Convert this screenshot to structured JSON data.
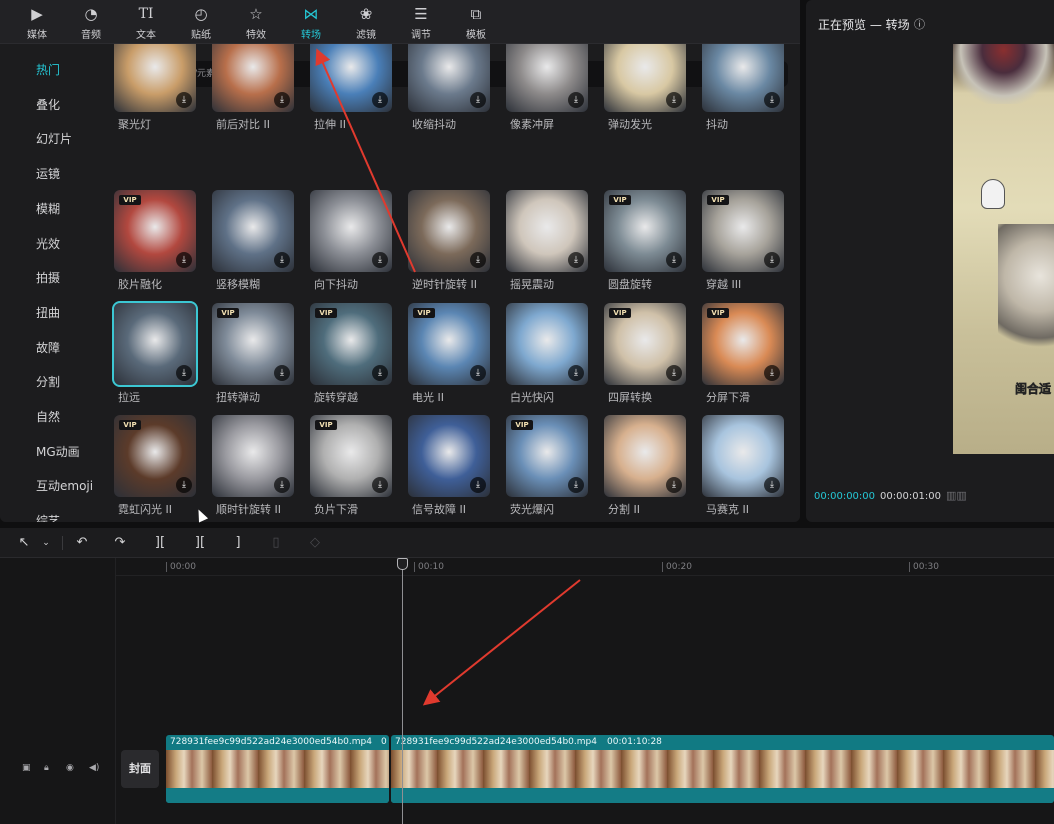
{
  "toolbar": {
    "items": [
      {
        "label": "媒体",
        "icon": "media-icon"
      },
      {
        "label": "音频",
        "icon": "audio-icon"
      },
      {
        "label": "文本",
        "icon": "text-icon"
      },
      {
        "label": "贴纸",
        "icon": "sticker-icon"
      },
      {
        "label": "特效",
        "icon": "effects-icon"
      },
      {
        "label": "转场",
        "icon": "transition-icon",
        "active": true
      },
      {
        "label": "滤镜",
        "icon": "filter-icon"
      },
      {
        "label": "调节",
        "icon": "adjust-icon"
      },
      {
        "label": "模板",
        "icon": "template-icon"
      }
    ]
  },
  "categories": [
    "热门",
    "叠化",
    "幻灯片",
    "运镜",
    "模糊",
    "光效",
    "拍摄",
    "扭曲",
    "故障",
    "分割",
    "自然",
    "MG动画",
    "互动emoji",
    "综艺"
  ],
  "active_category": "热门",
  "search": {
    "placeholder": "搜索转场名称/元素"
  },
  "transitions": [
    {
      "name": "聚光灯",
      "vip": false
    },
    {
      "name": "前后对比 II",
      "vip": false
    },
    {
      "name": "拉伸 II",
      "vip": false
    },
    {
      "name": "收缩抖动",
      "vip": false
    },
    {
      "name": "像素冲屏",
      "vip": false
    },
    {
      "name": "弹动发光",
      "vip": false
    },
    {
      "name": "抖动",
      "vip": false
    },
    {
      "name": "胶片融化",
      "vip": true
    },
    {
      "name": "竖移模糊",
      "vip": false
    },
    {
      "name": "向下抖动",
      "vip": false
    },
    {
      "name": "逆时针旋转 II",
      "vip": false
    },
    {
      "name": "摇晃震动",
      "vip": false
    },
    {
      "name": "圆盘旋转",
      "vip": true
    },
    {
      "name": "穿越 III",
      "vip": true
    },
    {
      "name": "拉远",
      "vip": false,
      "selected": true
    },
    {
      "name": "扭转弹动",
      "vip": true
    },
    {
      "name": "旋转穿越",
      "vip": true
    },
    {
      "name": "电光 II",
      "vip": true
    },
    {
      "name": "白光快闪",
      "vip": false
    },
    {
      "name": "四屏转换",
      "vip": true
    },
    {
      "name": "分屏下滑",
      "vip": true
    },
    {
      "name": "霓虹闪光 II",
      "vip": true
    },
    {
      "name": "顺时针旋转 II",
      "vip": false
    },
    {
      "name": "负片下滑",
      "vip": true
    },
    {
      "name": "信号故障 II",
      "vip": false
    },
    {
      "name": "荧光爆闪",
      "vip": true
    },
    {
      "name": "分割 II",
      "vip": false
    },
    {
      "name": "马赛克 II",
      "vip": false
    }
  ],
  "tile_colors": [
    "#c99d69",
    "#b86f4b",
    "#4a7fb8",
    "#6b7a8c",
    "#8d8a8a",
    "#d8c8a3",
    "#6a88a3",
    "#b2483f",
    "#5f7187",
    "#8c8f96",
    "#7c6a5a",
    "#cfc6bb",
    "#7d8b94",
    "#a7a39b",
    "#5a6a7a",
    "#7f8b99",
    "#4f6d7c",
    "#5b86b3",
    "#7ea8cf",
    "#cfc0a8",
    "#d98a55",
    "#5c3b2a",
    "#9a9aa0",
    "#b0b0b0",
    "#3f5f98",
    "#6a8fb7",
    "#d7b08e",
    "#a8c4de"
  ],
  "vip_badge": "VIP",
  "preview": {
    "title": "正在预览 — 转场",
    "caption": "闺合适",
    "time_current": "00:00:00:00",
    "time_total": "00:00:01:00"
  },
  "timeline": {
    "ticks": [
      "00:00",
      "00:10",
      "00:20",
      "00:30"
    ],
    "cover_label": "封面",
    "clip1_title": "728931fee9c99d522ad24e3000ed54b0.mp4",
    "clip1_tail": "0",
    "clip2_title": "728931fee9c99d522ad24e3000ed54b0.mp4",
    "clip2_duration": "00:01:10:28"
  },
  "colors": {
    "accent": "#25c7d5",
    "annotation": "#e03a2e",
    "clip": "#117a83"
  }
}
